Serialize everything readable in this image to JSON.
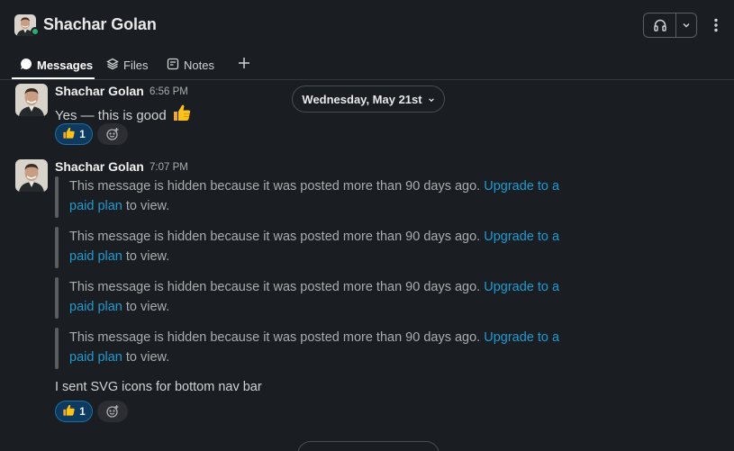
{
  "header": {
    "title": "Shachar Golan",
    "presence": "online",
    "huddle_icon": "headphones-icon",
    "menu_icon": "kebab-icon"
  },
  "tabs": [
    {
      "label": "Messages",
      "icon": "message-bubble-icon",
      "active": true
    },
    {
      "label": "Files",
      "icon": "stack-icon",
      "active": false
    },
    {
      "label": "Notes",
      "icon": "notes-icon",
      "active": false
    }
  ],
  "date_divider": "Wednesday, May 21st",
  "messages": [
    {
      "sender": "Shachar Golan",
      "time": "6:56 PM",
      "text": "Yes — this is good",
      "reaction": {
        "emoji": "thumbs-up",
        "count": "1"
      }
    },
    {
      "sender": "Shachar Golan",
      "time": "7:07 PM",
      "hidden": [
        {
          "text": "This message is hidden because it was posted more than 90 days ago.",
          "link": "Upgrade to a paid plan",
          "suffix": "to view."
        },
        {
          "text": "This message is hidden because it was posted more than 90 days ago.",
          "link": "Upgrade to a paid plan",
          "suffix": "to view."
        },
        {
          "text": "This message is hidden because it was posted more than 90 days ago.",
          "link": "Upgrade to a paid plan",
          "suffix": "to view."
        },
        {
          "text": "This message is hidden because it was posted more than 90 days ago.",
          "link": "Upgrade to a paid plan",
          "suffix": "to view."
        }
      ],
      "text": "I sent SVG icons for bottom nav bar",
      "reaction": {
        "emoji": "thumbs-up",
        "count": "1"
      }
    }
  ],
  "colors": {
    "background": "#1a1d21",
    "link": "#1d9bd1",
    "reaction_bg": "#0d3a5e",
    "presence": "#2bac76"
  }
}
